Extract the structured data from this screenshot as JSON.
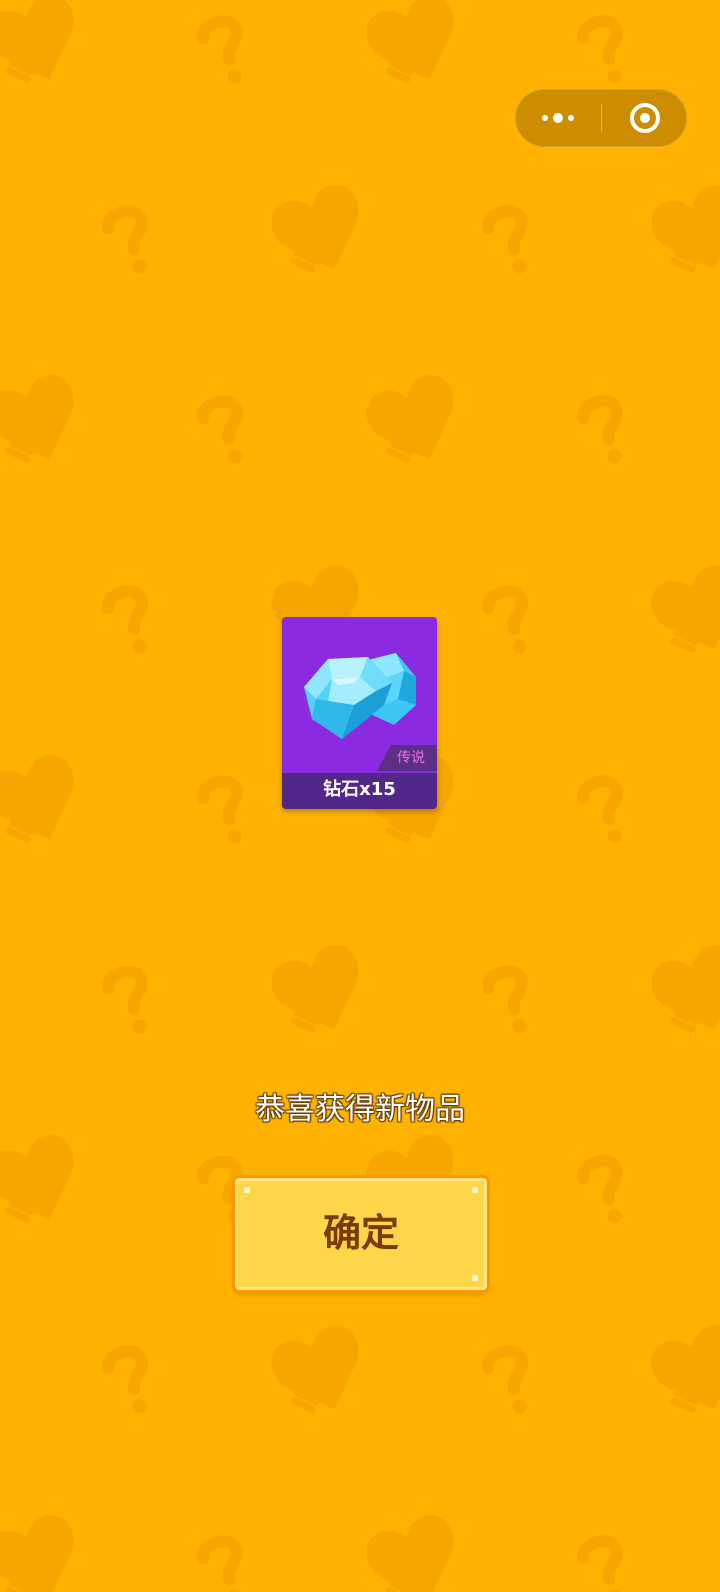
{
  "capsule": {
    "more_icon": "more-dots-icon",
    "close_icon": "target-close-icon"
  },
  "reward": {
    "item_name": "钻石x15",
    "rarity": "传说",
    "item_icon": "diamond-icon"
  },
  "message": "恭喜获得新物品",
  "confirm_button_label": "确定",
  "colors": {
    "background": "#FFB300",
    "card": "#8A2BE2",
    "card_label_bar": "#51288A",
    "rarity_text": "#E577E0",
    "button": "#FFD54A",
    "button_border": "#FF9500",
    "button_text": "#7A3A00"
  }
}
